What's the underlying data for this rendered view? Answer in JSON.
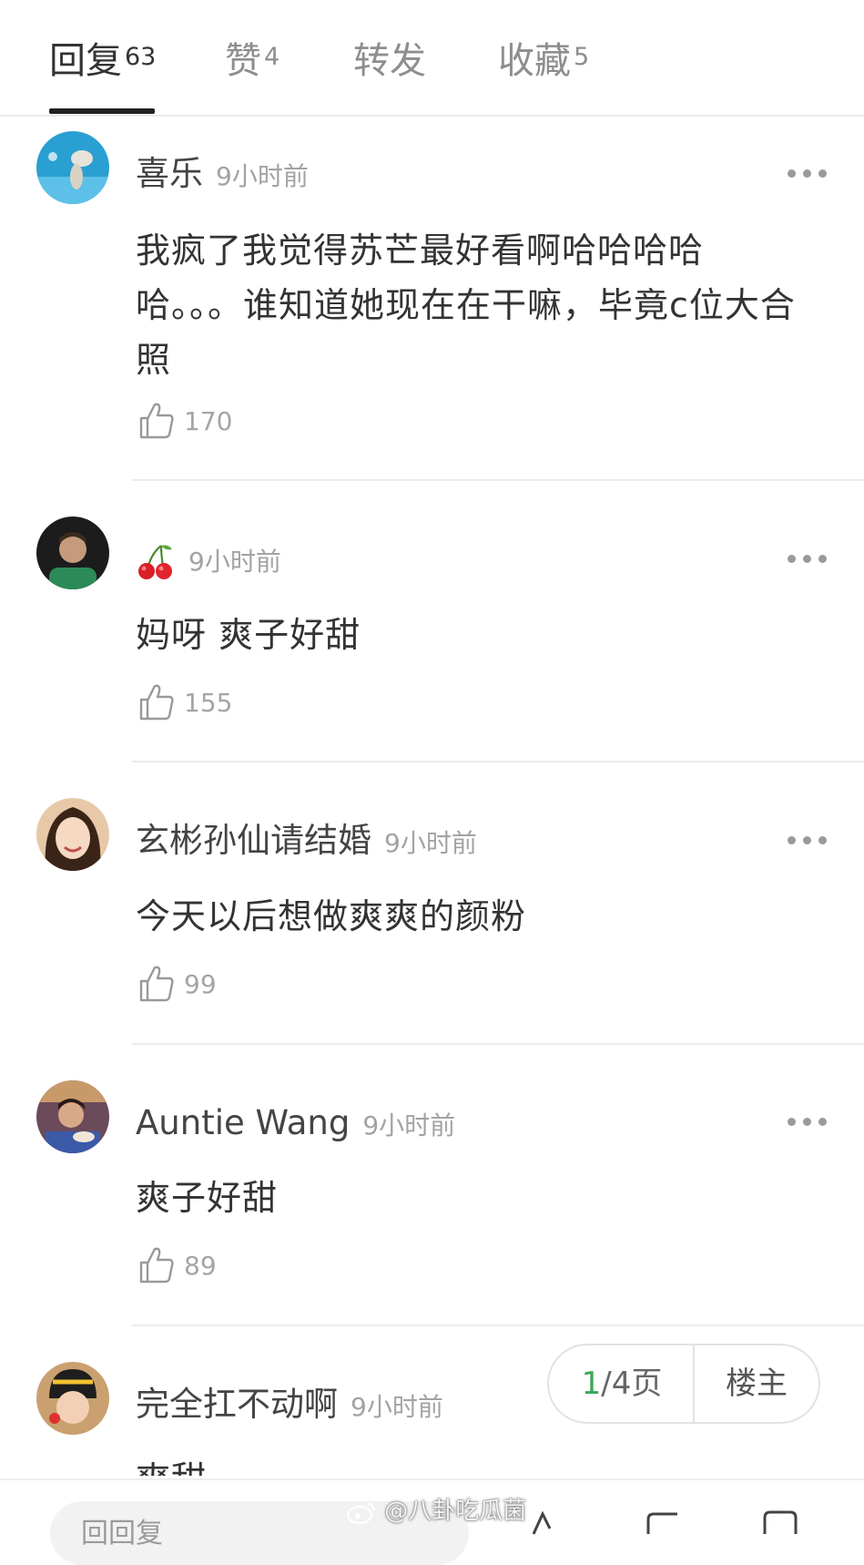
{
  "tabs": [
    {
      "label": "回复",
      "count": "63"
    },
    {
      "label": "赞",
      "count": "4"
    },
    {
      "label": "转发",
      "count": ""
    },
    {
      "label": "收藏",
      "count": "5"
    }
  ],
  "comments": [
    {
      "name": "喜乐",
      "time": "9小时前",
      "text": "我疯了我觉得苏芒最好看啊哈哈哈哈\n哈。。。谁知道她现在在干嘛，毕竟c位大合\n照",
      "likes": "170"
    },
    {
      "name": "",
      "name_icon": "cherry-emoji",
      "time": "9小时前",
      "text": "妈呀 爽子好甜",
      "likes": "155"
    },
    {
      "name": "玄彬孙仙请结婚",
      "time": "9小时前",
      "text": "今天以后想做爽爽的颜粉",
      "likes": "99"
    },
    {
      "name": "Auntie Wang",
      "time": "9小时前",
      "text": "爽子好甜",
      "likes": "89"
    },
    {
      "name": "完全扛不动啊",
      "time": "9小时前",
      "text": "爽甜",
      "likes": ""
    }
  ],
  "pager": {
    "current": "1",
    "rest": "/4页",
    "author_only": "楼主"
  },
  "bottom": {
    "reply_placeholder": "回回复"
  },
  "watermark": "@八卦吃瓜菌",
  "colors": {
    "accent_green": "#3aa655",
    "tab_active": "#333333",
    "tab_inactive": "#8e8e8e"
  }
}
